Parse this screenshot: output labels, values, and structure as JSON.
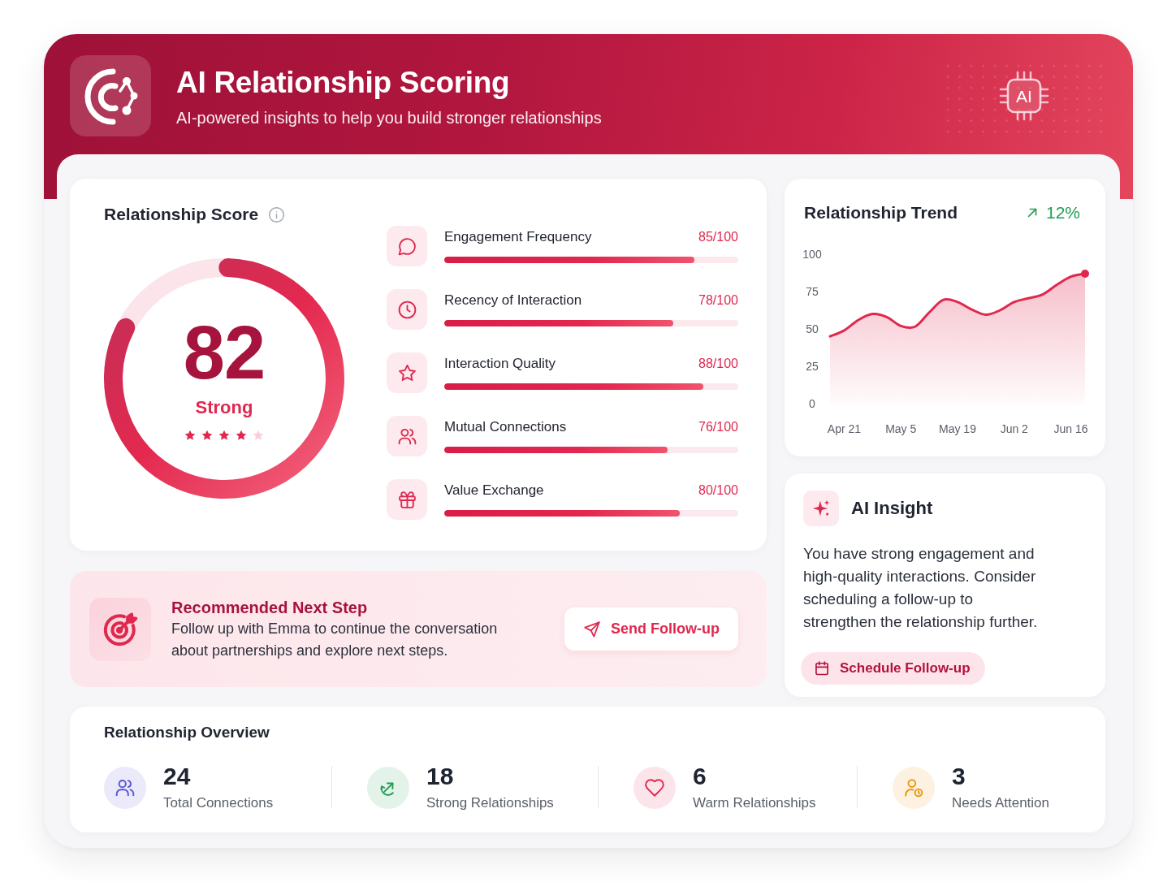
{
  "header": {
    "title": "AI Relationship Scoring",
    "subtitle": "AI-powered insights to help you build stronger relationships",
    "badge": "AI"
  },
  "score_card": {
    "title": "Relationship Score",
    "score": "82",
    "rating": "Strong",
    "level": 0.82,
    "stars": 4,
    "metrics": [
      {
        "label": "Engagement Frequency",
        "value": "85/100",
        "level": 0.85
      },
      {
        "label": "Recency of Interaction",
        "value": "78/100",
        "level": 0.78
      },
      {
        "label": "Interaction Quality",
        "value": "88/100",
        "level": 0.88
      },
      {
        "label": "Mutual Connections",
        "value": "76/100",
        "level": 0.76
      },
      {
        "label": "Value Exchange",
        "value": "80/100",
        "level": 0.8
      }
    ]
  },
  "trend": {
    "title": "Relationship Trend",
    "change": "12%",
    "chart_data": {
      "type": "area",
      "categories": [
        null,
        "Apr 21",
        null,
        null,
        null,
        "May 5",
        null,
        null,
        null,
        "May 19",
        null,
        null,
        null,
        "Jun 2",
        null,
        null,
        null,
        "Jun 16",
        null
      ],
      "series": [
        {
          "color": "#e0284f",
          "values": [
            45,
            49,
            56,
            60,
            58,
            52,
            51.5,
            61,
            69.5,
            68,
            63,
            59.5,
            62.5,
            68,
            70.5,
            73,
            79.5,
            85,
            87
          ]
        }
      ],
      "ylim": [
        0,
        100
      ],
      "yticks": [
        0,
        25,
        50,
        75,
        100
      ]
    }
  },
  "recommendation": {
    "title": "Recommended Next Step",
    "text": "Follow up with Emma to continue the conversation about partnerships and explore next steps.",
    "button": "Send Follow-up"
  },
  "insight": {
    "title": "AI Insight",
    "text": "You have strong engagement and high-quality interactions. Consider scheduling a follow-up to strengthen the relationship further.",
    "button": "Schedule Follow-up"
  },
  "overview": {
    "title": "Relationship Overview",
    "items": [
      {
        "value": "24",
        "label": "Total Connections",
        "color": "#5856d6"
      },
      {
        "value": "18",
        "label": "Strong Relationships",
        "color": "#1f9d55"
      },
      {
        "value": "6",
        "label": "Warm Relationships",
        "color": "#e0284f"
      },
      {
        "value": "3",
        "label": "Needs Attention",
        "color": "#f0960e"
      }
    ]
  }
}
